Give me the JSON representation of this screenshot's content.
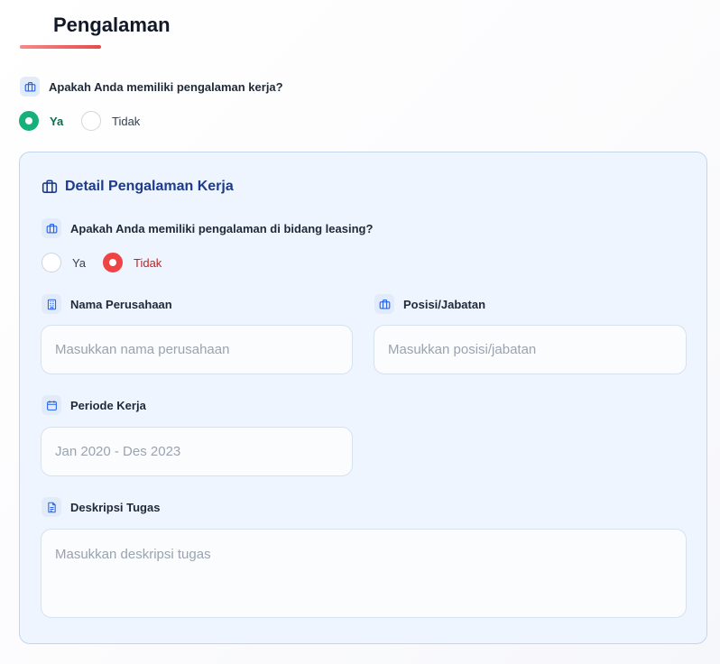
{
  "section": {
    "title": "Pengalaman"
  },
  "experience_question": {
    "label": "Apakah Anda memiliki pengalaman kerja?",
    "options": [
      {
        "label": "Ya",
        "selected": true
      },
      {
        "label": "Tidak",
        "selected": false
      }
    ]
  },
  "detail": {
    "title": "Detail Pengalaman Kerja",
    "leasing_question": {
      "label": "Apakah Anda memiliki pengalaman di bidang leasing?",
      "options": [
        {
          "label": "Ya",
          "selected": false
        },
        {
          "label": "Tidak",
          "selected": true
        }
      ]
    },
    "company": {
      "label": "Nama Perusahaan",
      "placeholder": "Masukkan nama perusahaan",
      "value": ""
    },
    "position": {
      "label": "Posisi/Jabatan",
      "placeholder": "Masukkan posisi/jabatan",
      "value": ""
    },
    "period": {
      "label": "Periode Kerja",
      "placeholder": "Jan 2020 - Des 2023",
      "value": ""
    },
    "description": {
      "label": "Deskripsi Tugas",
      "placeholder": "Masukkan deskripsi tugas",
      "value": ""
    }
  },
  "colors": {
    "accent_red": "#ef4444",
    "accent_green": "#16b07a",
    "heading_blue": "#1e3a8a",
    "icon_blue": "#2563eb"
  },
  "icons": {
    "briefcase": "briefcase-icon",
    "building": "building-icon",
    "calendar": "calendar-icon",
    "document": "document-icon"
  }
}
